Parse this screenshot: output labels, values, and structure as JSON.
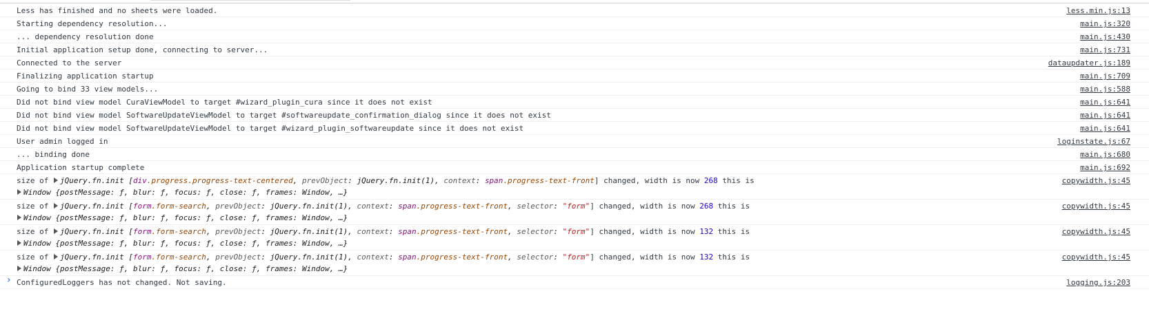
{
  "messages": [
    {
      "text": "Less has finished and no sheets were loaded.",
      "source": "less.min.js:13"
    },
    {
      "text": "Starting dependency resolution...",
      "source": "main.js:320"
    },
    {
      "text": "... dependency resolution done",
      "source": "main.js:430"
    },
    {
      "text": "Initial application setup done, connecting to server...",
      "source": "main.js:731"
    },
    {
      "text": "Connected to the server",
      "source": "dataupdater.js:189"
    },
    {
      "text": "Finalizing application startup",
      "source": "main.js:709"
    },
    {
      "text": "Going to bind 33 view models...",
      "source": "main.js:588"
    },
    {
      "text": "Did not bind view model CuraViewModel to target #wizard_plugin_cura since it does not exist",
      "source": "main.js:641"
    },
    {
      "text": "Did not bind view model SoftwareUpdateViewModel to target #softwareupdate_confirmation_dialog since it does not exist",
      "source": "main.js:641"
    },
    {
      "text": "Did not bind view model SoftwareUpdateViewModel to target #wizard_plugin_softwareupdate since it does not exist",
      "source": "main.js:641"
    },
    {
      "text": "User admin logged in",
      "source": "loginstate.js:67"
    },
    {
      "text": "... binding done",
      "source": "main.js:680"
    },
    {
      "text": "Application startup complete",
      "source": "main.js:692"
    }
  ],
  "size_logs": [
    {
      "prefix": "size of ",
      "obj": "jQuery.fn.init [",
      "elem_tag": "div",
      "elem_class": ".progress.progress-text-centered",
      "prev_key": "prevObject",
      "prev_val": "jQuery.fn.init(1)",
      "ctx_key": "context",
      "ctx_tag": "span",
      "ctx_class": ".progress-text-front",
      "sel_key": "",
      "sel_val": "",
      "mid": "] changed, width is now ",
      "width": "268",
      "suffix": " this is",
      "window_label": "Window {",
      "window_props": "postMessage: ƒ, blur: ƒ, focus: ƒ, close: ƒ, frames: Window, …}",
      "source": "copywidth.js:45"
    },
    {
      "prefix": "size of ",
      "obj": "jQuery.fn.init [",
      "elem_tag": "form",
      "elem_class": ".form-search",
      "prev_key": "prevObject",
      "prev_val": "jQuery.fn.init(1)",
      "ctx_key": "context",
      "ctx_tag": "span",
      "ctx_class": ".progress-text-front",
      "sel_key": "selector",
      "sel_val": "\"form\"",
      "mid": "] changed, width is now ",
      "width": "268",
      "suffix": " this is",
      "window_label": "Window {",
      "window_props": "postMessage: ƒ, blur: ƒ, focus: ƒ, close: ƒ, frames: Window, …}",
      "source": "copywidth.js:45"
    },
    {
      "prefix": "size of ",
      "obj": "jQuery.fn.init [",
      "elem_tag": "form",
      "elem_class": ".form-search",
      "prev_key": "prevObject",
      "prev_val": "jQuery.fn.init(1)",
      "ctx_key": "context",
      "ctx_tag": "span",
      "ctx_class": ".progress-text-front",
      "sel_key": "selector",
      "sel_val": "\"form\"",
      "mid": "] changed, width is now ",
      "width": "132",
      "suffix": " this is",
      "window_label": "Window {",
      "window_props": "postMessage: ƒ, blur: ƒ, focus: ƒ, close: ƒ, frames: Window, …}",
      "source": "copywidth.js:45"
    },
    {
      "prefix": "size of ",
      "obj": "jQuery.fn.init [",
      "elem_tag": "form",
      "elem_class": ".form-search",
      "prev_key": "prevObject",
      "prev_val": "jQuery.fn.init(1)",
      "ctx_key": "context",
      "ctx_tag": "span",
      "ctx_class": ".progress-text-front",
      "sel_key": "selector",
      "sel_val": "\"form\"",
      "mid": "] changed, width is now ",
      "width": "132",
      "suffix": " this is",
      "window_label": "Window {",
      "window_props": "postMessage: ƒ, blur: ƒ, focus: ƒ, close: ƒ, frames: Window, …}",
      "source": "copywidth.js:45"
    }
  ],
  "final_message": {
    "text": "ConfiguredLoggers has not changed. Not saving.",
    "source": "logging.js:203"
  },
  "prompt": {
    "icon": "chevron-right-icon",
    "glyph": "›"
  },
  "colors": {
    "link": "#303942",
    "number": "#1c00cf",
    "string": "#c41a16",
    "tag": "#881280",
    "class": "#994500",
    "prompt": "#1a73e8"
  }
}
